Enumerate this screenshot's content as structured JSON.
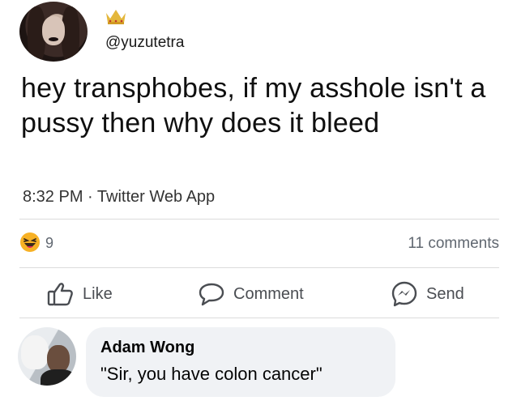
{
  "post": {
    "handle": "@yuzutetra",
    "text": "hey transphobes, if my asshole isn't a pussy then why does it bleed",
    "meta": "8:32 PM · Twitter Web App"
  },
  "reactions": {
    "count": "9",
    "comments": "11 comments"
  },
  "actions": {
    "like_label": "Like",
    "comment_label": "Comment",
    "send_label": "Send"
  },
  "comment": {
    "author": "Adam Wong",
    "text": "\"Sir, you have colon cancer\""
  },
  "colors": {
    "icon_gray": "#4a4d52",
    "bubble_bg": "#f0f2f5",
    "haha_yellow": "#f7b125",
    "crown_gold": "#e4b73b"
  }
}
